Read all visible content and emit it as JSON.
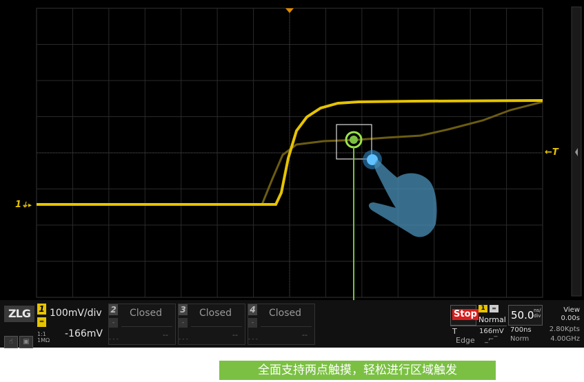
{
  "channels": [
    {
      "number": "1",
      "coupling_icon": "dc-coupling",
      "scale": "100mV/div",
      "offset": "-166mV",
      "impedance": "1:1\n1MΩ"
    },
    {
      "number": "2",
      "status": "Closed",
      "value": "--"
    },
    {
      "number": "3",
      "status": "Closed",
      "value": "--"
    },
    {
      "number": "4",
      "status": "Closed",
      "value": "--"
    }
  ],
  "brand": "ZLG",
  "ground_marker": "1",
  "trigger_marker": "T",
  "run_state": "Stop",
  "trigger": {
    "channel": "1",
    "mode": "Normal",
    "label": "T",
    "level": "166mV",
    "type": "Edge"
  },
  "timebase": {
    "value": "50.0",
    "unit": "ns/div",
    "delay": "700ns",
    "sample_rate_label": "Norm"
  },
  "acquisition": {
    "view": "View",
    "view_offset": "0.00s",
    "memory": "2.80Kpts",
    "sample_rate": "4.00GHz"
  },
  "caption": "全面支持两点触摸，轻松进行区域触发",
  "colors": {
    "channel1": "#e6c300",
    "accent": "#7bc043",
    "stop": "#d91e1e",
    "touch": "#3fa9f5"
  }
}
